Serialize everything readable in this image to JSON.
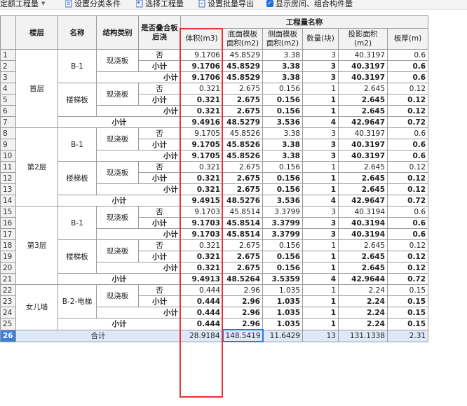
{
  "toolbar": {
    "items": [
      {
        "label": "定额工程量",
        "icon": "dropdown-icon"
      },
      {
        "label": "设置分类条件",
        "icon": "list-icon"
      },
      {
        "label": "选择工程量",
        "icon": "select-icon"
      },
      {
        "label": "设置批量导出",
        "icon": "export-icon"
      },
      {
        "label": "显示房间、组合构件量",
        "icon": "checkbox-checked-icon",
        "checked": true
      }
    ]
  },
  "table": {
    "headers": {
      "floor": "楼层",
      "name": "名称",
      "struct": "结构类别",
      "overlap": "是否叠合板后浇",
      "group": "工程量名称",
      "volume": "体积(m3)",
      "bottom": "底面模板面积(m2)",
      "side": "侧面模板面积(m2)",
      "count": "数量(块)",
      "proj": "投影面积(m2)",
      "thick": "板厚(m)"
    },
    "floors": [
      "首层",
      "第2层",
      "第3层",
      "女儿墙"
    ],
    "names": [
      "B-1",
      "楼梯板",
      "B-1",
      "楼梯板",
      "B-1",
      "楼梯板",
      "B-2-电梯"
    ],
    "struct_label": "现浇板",
    "no_label": "否",
    "subtotal_label": "小计",
    "total_label": "合计",
    "rows": [
      {
        "n": "1",
        "v": [
          "9.1706",
          "45.8529",
          "3.38",
          "3",
          "40.3197",
          "0.6"
        ]
      },
      {
        "n": "2",
        "v": [
          "9.1706",
          "45.8529",
          "3.38",
          "3",
          "40.3197",
          "0.6"
        ]
      },
      {
        "n": "3",
        "v": [
          "9.1706",
          "45.8529",
          "3.38",
          "3",
          "40.3197",
          "0.6"
        ]
      },
      {
        "n": "4",
        "v": [
          "0.321",
          "2.675",
          "0.156",
          "1",
          "2.645",
          "0.12"
        ]
      },
      {
        "n": "5",
        "v": [
          "0.321",
          "2.675",
          "0.156",
          "1",
          "2.645",
          "0.12"
        ]
      },
      {
        "n": "6",
        "v": [
          "0.321",
          "2.675",
          "0.156",
          "1",
          "2.645",
          "0.12"
        ]
      },
      {
        "n": "7",
        "v": [
          "9.4916",
          "48.5279",
          "3.536",
          "4",
          "42.9647",
          "0.72"
        ]
      },
      {
        "n": "8",
        "v": [
          "9.1705",
          "45.8526",
          "3.38",
          "3",
          "40.3197",
          "0.6"
        ]
      },
      {
        "n": "9",
        "v": [
          "9.1705",
          "45.8526",
          "3.38",
          "3",
          "40.3197",
          "0.6"
        ]
      },
      {
        "n": "10",
        "v": [
          "9.1705",
          "45.8526",
          "3.38",
          "3",
          "40.3197",
          "0.6"
        ]
      },
      {
        "n": "11",
        "v": [
          "0.321",
          "2.675",
          "0.156",
          "1",
          "2.645",
          "0.12"
        ]
      },
      {
        "n": "12",
        "v": [
          "0.321",
          "2.675",
          "0.156",
          "1",
          "2.645",
          "0.12"
        ]
      },
      {
        "n": "13",
        "v": [
          "0.321",
          "2.675",
          "0.156",
          "1",
          "2.645",
          "0.12"
        ]
      },
      {
        "n": "14",
        "v": [
          "9.4915",
          "48.5276",
          "3.536",
          "4",
          "42.9647",
          "0.72"
        ]
      },
      {
        "n": "15",
        "v": [
          "9.1703",
          "45.8514",
          "3.3799",
          "3",
          "40.3194",
          "0.6"
        ]
      },
      {
        "n": "16",
        "v": [
          "9.1703",
          "45.8514",
          "3.3799",
          "3",
          "40.3194",
          "0.6"
        ]
      },
      {
        "n": "17",
        "v": [
          "9.1703",
          "45.8514",
          "3.3799",
          "3",
          "40.3194",
          "0.6"
        ]
      },
      {
        "n": "18",
        "v": [
          "0.321",
          "2.675",
          "0.156",
          "1",
          "2.645",
          "0.12"
        ]
      },
      {
        "n": "19",
        "v": [
          "0.321",
          "2.675",
          "0.156",
          "1",
          "2.645",
          "0.12"
        ]
      },
      {
        "n": "20",
        "v": [
          "0.321",
          "2.675",
          "0.156",
          "1",
          "2.645",
          "0.12"
        ]
      },
      {
        "n": "21",
        "v": [
          "9.4913",
          "48.5264",
          "3.5359",
          "4",
          "42.9644",
          "0.72"
        ]
      },
      {
        "n": "22",
        "v": [
          "0.444",
          "2.96",
          "1.035",
          "1",
          "2.24",
          "0.15"
        ]
      },
      {
        "n": "23",
        "v": [
          "0.444",
          "2.96",
          "1.035",
          "1",
          "2.24",
          "0.15"
        ]
      },
      {
        "n": "24",
        "v": [
          "0.444",
          "2.96",
          "1.035",
          "1",
          "2.24",
          "0.15"
        ]
      },
      {
        "n": "25",
        "v": [
          "0.444",
          "2.96",
          "1.035",
          "1",
          "2.24",
          "0.15"
        ]
      },
      {
        "n": "26",
        "v": [
          "28.9184",
          "148.5419",
          "11.6429",
          "13",
          "131.1338",
          "2.31"
        ]
      }
    ]
  },
  "colors": {
    "highlight_box": "#e83030",
    "selected_cell": "#2e7ad8",
    "total_row_bg": "#dde9f7",
    "header_bg": "#f2f2f2"
  }
}
